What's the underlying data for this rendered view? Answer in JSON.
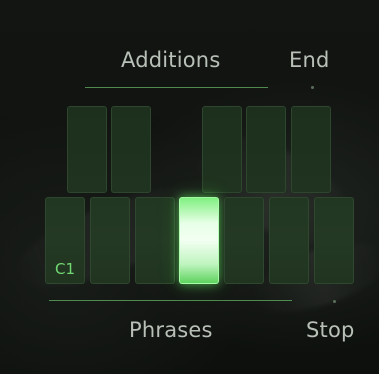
{
  "labels": {
    "additions": "Additions",
    "end": "End",
    "phrases": "Phrases",
    "stop": "Stop"
  },
  "keys": {
    "note_label": "C1",
    "active_key_number": 4
  }
}
